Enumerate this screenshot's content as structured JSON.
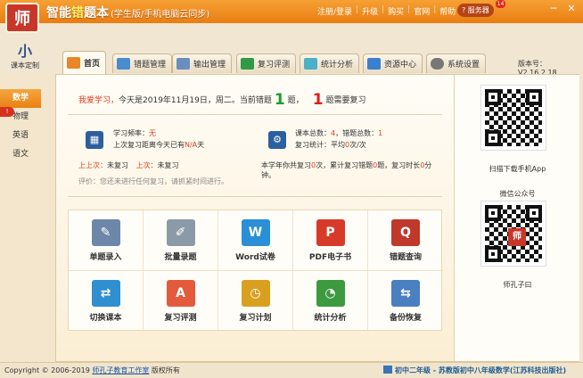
{
  "app": {
    "logo_text": "师",
    "title_pre": "智能",
    "title_hl": "错",
    "title_post": "题本",
    "subtitle": "(学生版/手机电脑云同步)"
  },
  "topmenu": [
    "注册/登录",
    "升级",
    "购买",
    "官网",
    "帮助"
  ],
  "service": {
    "label": "服务器",
    "badge": "14"
  },
  "window_buttons": [
    "─",
    "✕"
  ],
  "course_button": {
    "icon": "小",
    "label": "课本定制"
  },
  "tabs": [
    {
      "label": "首页",
      "color": "#e8862a",
      "active": true
    },
    {
      "label": "错题管理",
      "color": "#4a8bd0"
    },
    {
      "label": "输出管理",
      "color": "#6a8fbf"
    },
    {
      "label": "复习评测",
      "color": "#2f9b45"
    },
    {
      "label": "统计分析",
      "color": "#4bb0c8"
    },
    {
      "label": "资源中心",
      "color": "#3b7fd0"
    },
    {
      "label": "系统设置",
      "color": "#777777"
    }
  ],
  "version": "版本号：V2.16.2.18",
  "subjects": [
    "数学",
    "物理",
    "英语",
    "语文"
  ],
  "subject_badge": "!",
  "greeting": {
    "prefix": "我爱学习，",
    "text1": "今天是2019年11月19日，周二。当前错题",
    "count1": "1",
    "unit1": "题，",
    "count2": "1",
    "text2": "题需要复习"
  },
  "review": {
    "freq_label": "学习频率：",
    "freq_value": "无",
    "last_review_text": "上次复习距离今天已有",
    "last_review_value": "N/A",
    "last_review_unit": "天",
    "last_time_label": "上上次：",
    "last_time_value": "未复习",
    "last_label": "上次：",
    "last_value": "未复习",
    "note": "评价：您还未进行任何复习，请抓紧时间进行。"
  },
  "summary": {
    "total_label": "课本总数：",
    "total_value": "4",
    "wrong_label": "错题总数：",
    "wrong_value": "1",
    "stat_label": "复习统计：",
    "stat_text": "平均",
    "stat_value": "0",
    "stat_unit": "次/次",
    "year_text_a": "本学年你共复习",
    "year_count": "0",
    "year_text_b": "次，累计复习错题",
    "year_wrong": "0",
    "year_text_c": "题，复习时长",
    "year_minutes": "0",
    "year_text_d": "分钟。"
  },
  "tiles": [
    {
      "label": "单题录入",
      "icon": "✎",
      "color": "#6d87a8"
    },
    {
      "label": "批量录题",
      "icon": "✐",
      "color": "#8c9aa8"
    },
    {
      "label": "Word试卷",
      "icon": "W",
      "color": "#2a8fd6"
    },
    {
      "label": "PDF电子书",
      "icon": "P",
      "color": "#d83a2a"
    },
    {
      "label": "错题查询",
      "icon": "Q",
      "color": "#c0392b"
    },
    {
      "label": "切换课本",
      "icon": "⇄",
      "color": "#2f8fd0"
    },
    {
      "label": "复习评测",
      "icon": "A",
      "color": "#e35a3c"
    },
    {
      "label": "复习计划",
      "icon": "◷",
      "color": "#d9a020"
    },
    {
      "label": "统计分析",
      "icon": "◔",
      "color": "#3d9a40"
    },
    {
      "label": "备份恢复",
      "icon": "⇆",
      "color": "#4a7fc0"
    }
  ],
  "qr": {
    "app_label": "扫描下载手机App",
    "wechat_label": "微信公众号",
    "account_name": "师孔子曰",
    "logo_text": "师"
  },
  "status": {
    "copyright": "Copyright © 2006-2019",
    "studio": "师孔子教育工作室",
    "rights": "版权所有",
    "course": "初中二年级 - 苏教版初中八年级数学(江苏科技出版社)"
  }
}
